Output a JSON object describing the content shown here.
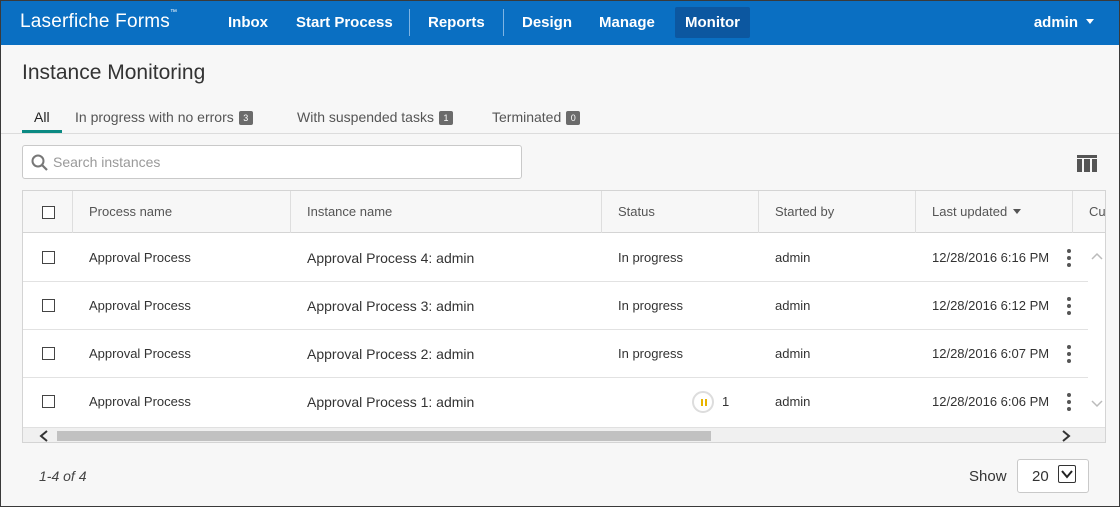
{
  "header": {
    "brand": "Laserfiche Forms",
    "brand_mark": "™",
    "nav": [
      "Inbox",
      "Start Process",
      "Reports",
      "Design",
      "Manage",
      "Monitor"
    ],
    "active": "Monitor",
    "user": "admin"
  },
  "page": {
    "title": "Instance Monitoring",
    "tabs": [
      {
        "label": "All",
        "active": true
      },
      {
        "label": "In progress with no errors",
        "count": "3"
      },
      {
        "label": "With suspended tasks",
        "count": "1"
      },
      {
        "label": "Terminated",
        "count": "0"
      }
    ],
    "search_placeholder": "Search instances"
  },
  "table": {
    "columns": [
      "Process name",
      "Instance name",
      "Status",
      "Started by",
      "Last updated",
      "Cu"
    ],
    "rows": [
      {
        "process": "Approval Process",
        "instance": "Approval Process 4: admin",
        "status": "In progress",
        "started_by": "admin",
        "updated": "12/28/2016 6:16 PM"
      },
      {
        "process": "Approval Process",
        "instance": "Approval Process 3: admin",
        "status": "In progress",
        "started_by": "admin",
        "updated": "12/28/2016 6:12 PM"
      },
      {
        "process": "Approval Process",
        "instance": "Approval Process 2: admin",
        "status": "In progress",
        "started_by": "admin",
        "updated": "12/28/2016 6:07 PM"
      },
      {
        "process": "Approval Process",
        "instance": "Approval Process 1: admin",
        "status": "",
        "suspended_count": "1",
        "started_by": "admin",
        "updated": "12/28/2016 6:06 PM"
      }
    ]
  },
  "footer": {
    "range": "1-4 of 4",
    "show_label": "Show",
    "page_size": "20"
  },
  "colors": {
    "topbar": "#0a6fc2",
    "active_nav": "#0c57a0",
    "tab_underline": "#0b8a83",
    "suspended_icon": "#e8b400"
  }
}
